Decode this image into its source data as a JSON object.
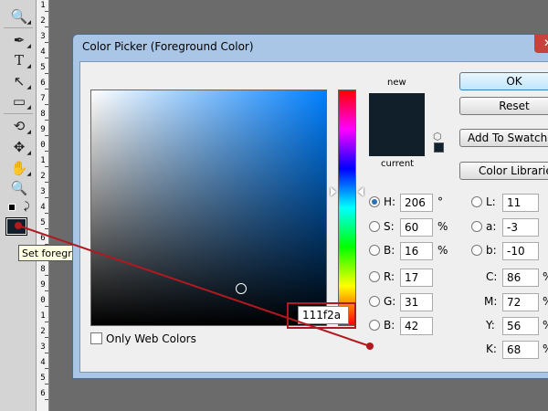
{
  "toolbar": {
    "tools": [
      "zoom-tool",
      "pen-tool",
      "type-tool",
      "path-select-tool",
      "shape-tool",
      "eyedropper-tool",
      "3d-rotate-tool",
      "hand-tool",
      "zoom-tool-2"
    ],
    "glyphs": {
      "zoom": "🔍",
      "pen": "✒",
      "type": "T",
      "arrow": "↖",
      "rect": "▭",
      "eyedropper": "✐",
      "move": "✥",
      "hand": "✋",
      "swap": "⤸"
    },
    "foreground_color": "#111f2a"
  },
  "ruler": {
    "numbers": [
      "1",
      "2",
      "3",
      "4",
      "5",
      "6",
      "7",
      "8",
      "9",
      "0",
      "1",
      "2",
      "3",
      "4",
      "5",
      "6",
      "7",
      "8",
      "9",
      "0",
      "1",
      "2",
      "3",
      "4",
      "5",
      "6"
    ]
  },
  "tooltip": {
    "text": "Set foregro"
  },
  "dialog": {
    "title": "Color Picker (Foreground Color)",
    "close_glyph": "✕",
    "only_web_colors_label": "Only Web Colors",
    "new_label": "new",
    "current_label": "current",
    "new_color": "#111f2a",
    "current_color": "#111f2a",
    "buttons": {
      "ok": "OK",
      "reset": "Reset",
      "add_to_swatches": "Add To Swatches",
      "color_libraries": "Color Libraries"
    },
    "hsb": [
      {
        "label": "H:",
        "value": "206",
        "unit": "°",
        "selected": true
      },
      {
        "label": "S:",
        "value": "60",
        "unit": "%",
        "selected": false
      },
      {
        "label": "B:",
        "value": "16",
        "unit": "%",
        "selected": false
      }
    ],
    "rgb": [
      {
        "label": "R:",
        "value": "17"
      },
      {
        "label": "G:",
        "value": "31"
      },
      {
        "label": "B:",
        "value": "42"
      }
    ],
    "lab": [
      {
        "label": "L:",
        "value": "11"
      },
      {
        "label": "a:",
        "value": "-3"
      },
      {
        "label": "b:",
        "value": "-10"
      }
    ],
    "cmyk": [
      {
        "label": "C:",
        "value": "86",
        "unit": "%"
      },
      {
        "label": "M:",
        "value": "72",
        "unit": "%"
      },
      {
        "label": "Y:",
        "value": "56",
        "unit": "%"
      },
      {
        "label": "K:",
        "value": "68",
        "unit": "%"
      }
    ],
    "hex": {
      "prefix": "#",
      "value": "111f2a"
    }
  },
  "colors": {
    "annotation_red": "#b0191f",
    "hue_slider_value": 206
  }
}
